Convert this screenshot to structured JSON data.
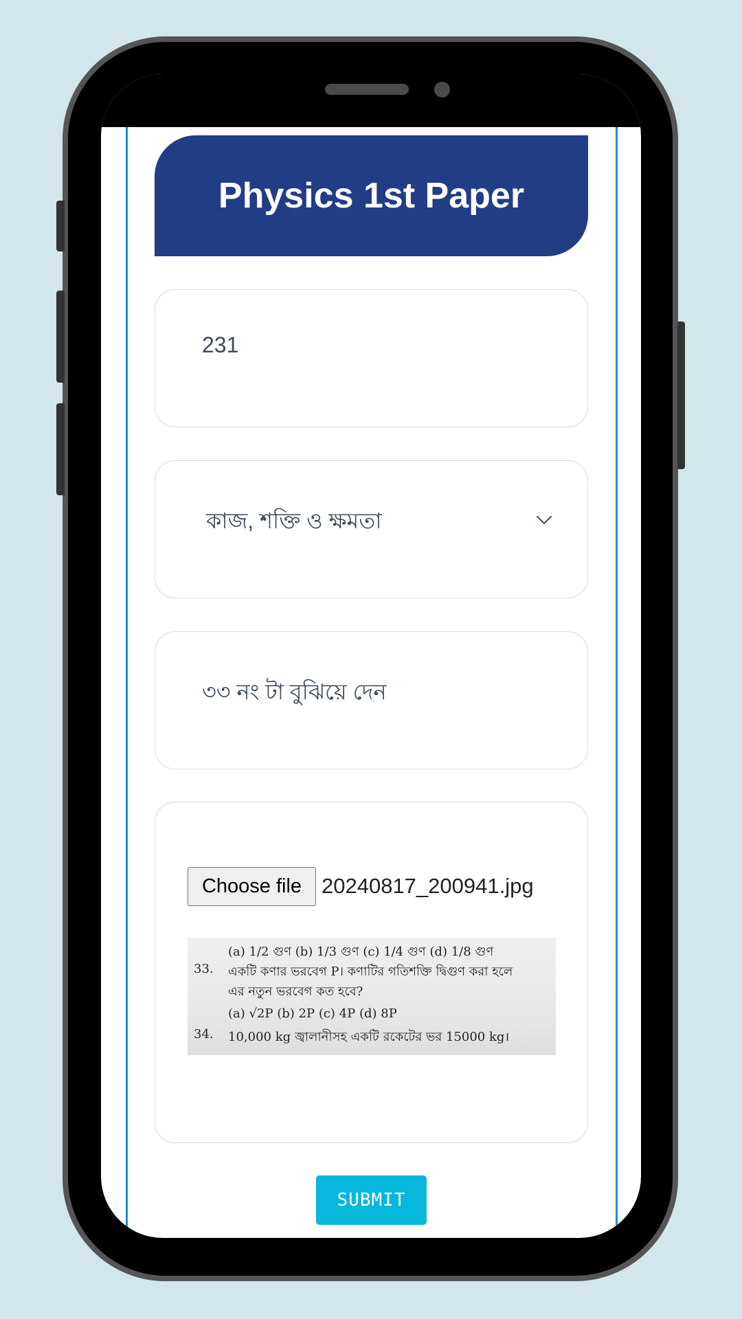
{
  "header": {
    "title": "Physics 1st Paper"
  },
  "form": {
    "number_value": "231",
    "chapter_selected": "কাজ, শক্তি ও ক্ষমতা",
    "question_text": "৩৩ নং টা বুঝিয়ে দেন",
    "file_button_label": "Choose file",
    "file_name": "20240817_200941.jpg",
    "submit_label": "SUBMIT"
  },
  "preview": {
    "line1": "(a) 1/2 গুণ  (b) 1/3 গুণ   (c) 1/4 গুণ   (d) 1/8 গুণ",
    "q33_num": "33.",
    "q33_text": "একটি কণার ভরবেগ P। কণাটির গতিশক্তি দ্বিগুণ করা হলে",
    "q33_text2": "এর নতুন ভরবেগ কত হবে?",
    "q33_options": "(a) √2P      (b) 2P        (c) 4P          (d) 8P",
    "q34_num": "34.",
    "q34_text": "10,000 kg জ্বালানীসহ একটি রকেটের ভর 15000 kg।"
  },
  "colors": {
    "header_bg": "#213d86",
    "submit_bg": "#07b8dc",
    "frame_border": "#1a8fd1",
    "page_bg": "#d3e6ec"
  }
}
